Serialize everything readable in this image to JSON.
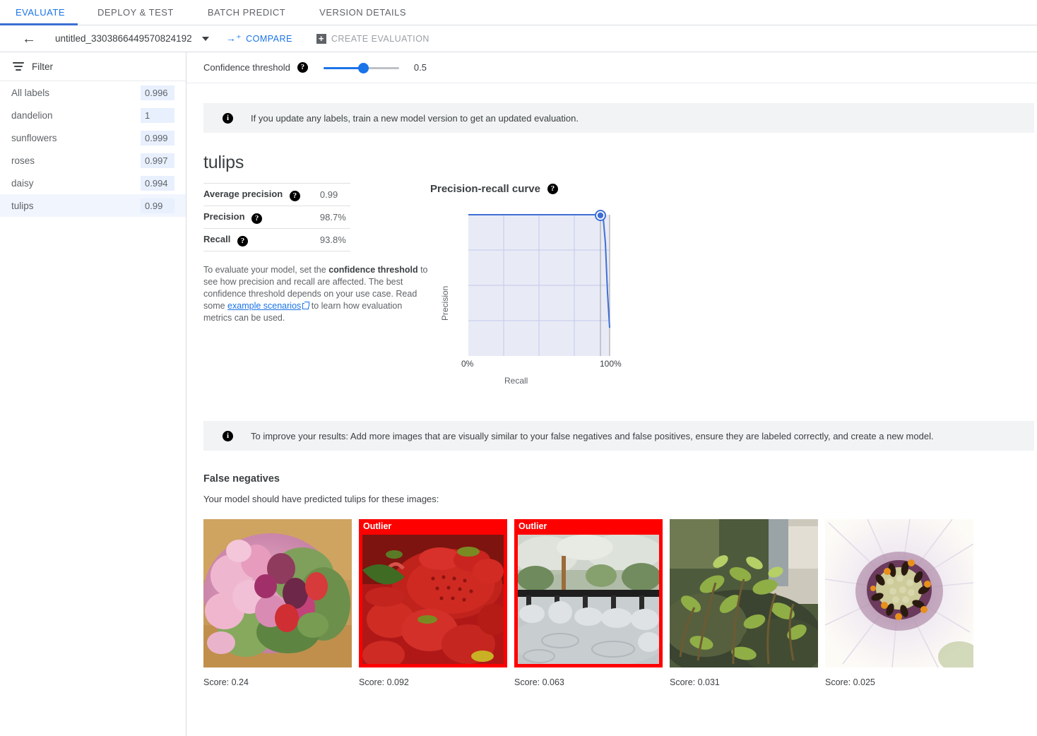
{
  "tabs": [
    {
      "label": "EVALUATE",
      "active": true
    },
    {
      "label": "DEPLOY & TEST",
      "active": false
    },
    {
      "label": "BATCH PREDICT",
      "active": false
    },
    {
      "label": "VERSION DETAILS",
      "active": false
    }
  ],
  "toolbar": {
    "back_icon": "arrow-left",
    "model_name": "untitled_3303866449570824192",
    "compare_label": "COMPARE",
    "create_evaluation_label": "CREATE EVALUATION"
  },
  "sidebar": {
    "filter_label": "Filter",
    "labels": [
      {
        "name": "All labels",
        "score": "0.996",
        "selected": false
      },
      {
        "name": "dandelion",
        "score": "1",
        "selected": false
      },
      {
        "name": "sunflowers",
        "score": "0.999",
        "selected": false
      },
      {
        "name": "roses",
        "score": "0.997",
        "selected": false
      },
      {
        "name": "daisy",
        "score": "0.994",
        "selected": false
      },
      {
        "name": "tulips",
        "score": "0.99",
        "selected": true
      }
    ]
  },
  "threshold": {
    "label": "Confidence threshold",
    "value": "0.5",
    "min": 0,
    "max": 1
  },
  "banner_top": {
    "text": "If you update any labels, train a new model version to get an updated evaluation."
  },
  "class_section": {
    "title": "tulips",
    "metrics": [
      {
        "name": "Average precision",
        "value": "0.99"
      },
      {
        "name": "Precision",
        "value": "98.7%"
      },
      {
        "name": "Recall",
        "value": "93.8%"
      }
    ],
    "help_part1": "To evaluate your model, set the ",
    "help_bold": "confidence threshold",
    "help_part2": " to see how precision and recall are affected. The best confidence threshold depends on your use case. Read some ",
    "help_link": "example scenarios",
    "help_part3": " to learn how evaluation metrics can be used."
  },
  "chart_data": {
    "type": "line",
    "title": "Precision-recall curve",
    "xlabel": "Recall",
    "ylabel": "Precision",
    "xticks": [
      "0%",
      "100%"
    ],
    "xlim": [
      0,
      1
    ],
    "ylim": [
      0,
      1
    ],
    "grid": true,
    "grid_x_lines": 4,
    "grid_y_lines": 4,
    "series": [
      {
        "name": "Precision-recall",
        "x": [
          0.0,
          0.2,
          0.4,
          0.6,
          0.8,
          0.9,
          0.938,
          0.955,
          0.97,
          0.985,
          1.0
        ],
        "y": [
          1.0,
          1.0,
          1.0,
          1.0,
          1.0,
          1.0,
          0.995,
          0.975,
          0.8,
          0.45,
          0.2
        ]
      }
    ],
    "marker": {
      "x": 0.938,
      "y": 1.0,
      "label": "current threshold operating point"
    }
  },
  "banner_bottom": {
    "text": "To improve your results: Add more images that are visually similar to your false negatives and false positives, ensure they are labeled correctly, and create a new model."
  },
  "false_negatives": {
    "title": "False negatives",
    "subtitle": "Your model should have predicted tulips for these images:",
    "outlier_label": "Outlier",
    "items": [
      {
        "score_label": "Score: 0.24",
        "outlier": false,
        "alt": "pink and purple tulip bouquet on wood floor"
      },
      {
        "score_label": "Score: 0.092",
        "outlier": true,
        "alt": "strawberries in a red colander"
      },
      {
        "score_label": "Score: 0.063",
        "outlier": true,
        "alt": "japanese garden pond with stones and black railing"
      },
      {
        "score_label": "Score: 0.031",
        "outlier": false,
        "alt": "green weeds growing on mossy rock"
      },
      {
        "score_label": "Score: 0.025",
        "outlier": false,
        "alt": "close-up of white daisy flower center"
      }
    ]
  },
  "colors": {
    "accent": "#1a73e8",
    "tab_underline": "#3b6fd4",
    "outlier": "#ff0000",
    "chart_fill": "#e8eaf6",
    "chart_line": "#3f6fd4",
    "chip_bg": "#e8f0fe",
    "banner_bg": "#f1f3f4"
  }
}
